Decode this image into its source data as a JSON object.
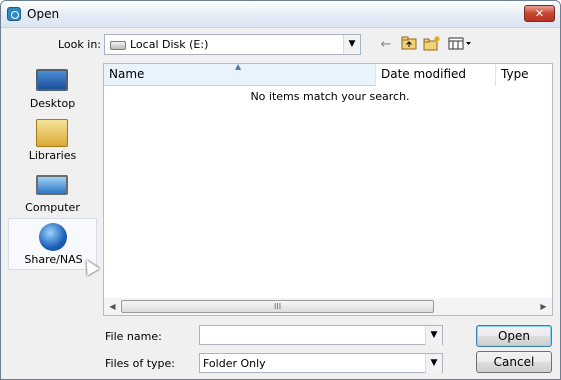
{
  "window": {
    "title": "Open",
    "close_glyph": "✕"
  },
  "toolbar": {
    "look_in_label": "Look in:",
    "look_in_value": "Local Disk (E:)",
    "icons": [
      "back-arrow-icon",
      "up-folder-icon",
      "new-folder-icon",
      "view-menu-icon"
    ]
  },
  "places": [
    {
      "label": "Desktop",
      "icon": "desktop-icon"
    },
    {
      "label": "Libraries",
      "icon": "libraries-icon"
    },
    {
      "label": "Computer",
      "icon": "computer-icon"
    },
    {
      "label": "Share/NAS",
      "icon": "share-nas-icon"
    }
  ],
  "file_list": {
    "columns": [
      "Name",
      "Date modified",
      "Type"
    ],
    "sorted_by": "Name",
    "empty_message": "No items match your search."
  },
  "form": {
    "file_name_label": "File name:",
    "file_name_value": "",
    "files_of_type_label": "Files of type:",
    "files_of_type_value": "Folder Only"
  },
  "buttons": {
    "open": "Open",
    "cancel": "Cancel"
  },
  "glyphs": {
    "dropdown": "▼",
    "sort_up": "▲",
    "scroll_left": "◀",
    "scroll_right": "▶",
    "grip": "III"
  }
}
